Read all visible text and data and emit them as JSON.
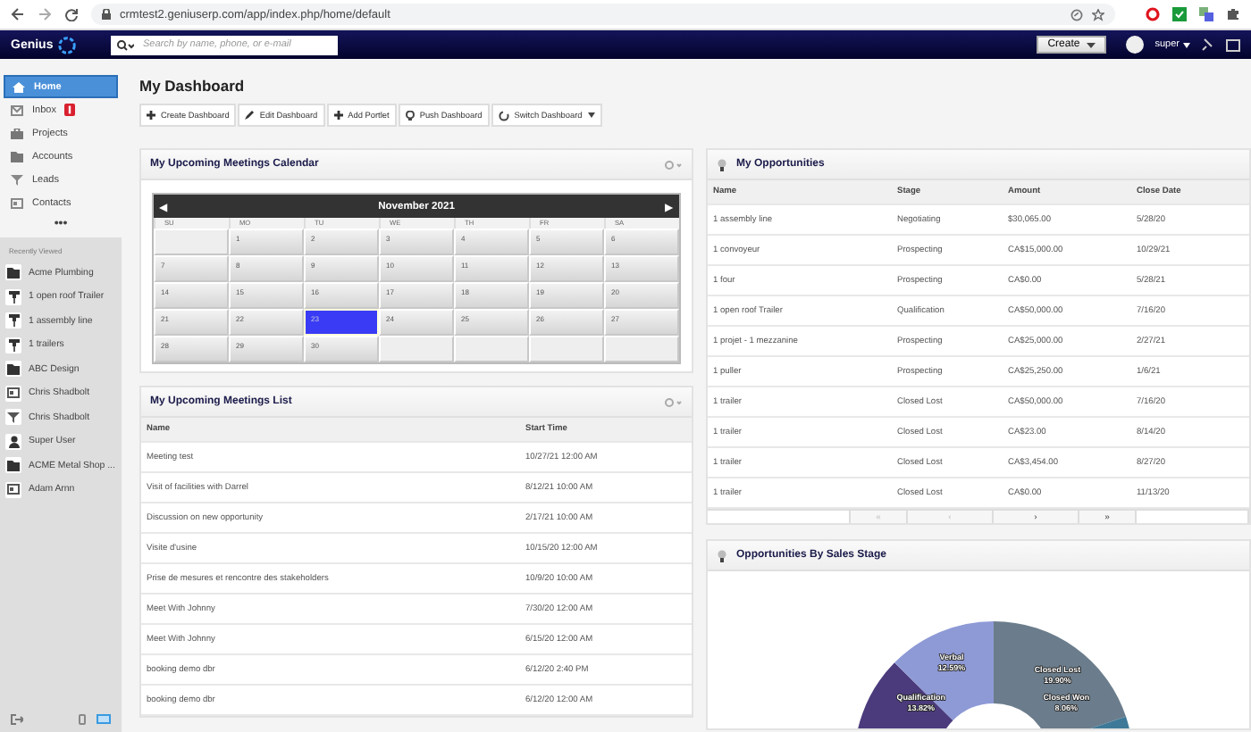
{
  "browser": {
    "url": "crmtest2.geniuserp.com/app/index.php/home/default"
  },
  "header": {
    "logo": "Genius",
    "search": {
      "placeholder": "Search by name, phone, or e-mail"
    },
    "create_button": "Create",
    "user": "super"
  },
  "sidebar": {
    "items": [
      {
        "label": "Home",
        "kind": "home",
        "selected": true,
        "badge": false
      },
      {
        "label": "Inbox",
        "kind": "inbox",
        "selected": false,
        "badge": true
      },
      {
        "label": "Projects",
        "kind": "projects",
        "selected": false,
        "badge": false
      },
      {
        "label": "Accounts",
        "kind": "accounts",
        "selected": false,
        "badge": false
      },
      {
        "label": "Leads",
        "kind": "leads",
        "selected": false,
        "badge": false
      },
      {
        "label": "Contacts",
        "kind": "contacts",
        "selected": false,
        "badge": false
      }
    ],
    "more": "•••",
    "recent_title": "Recently Viewed",
    "recent": [
      {
        "label": "Acme Plumbing",
        "kind": "account"
      },
      {
        "label": "1 open roof Trailer",
        "kind": "opportunity"
      },
      {
        "label": "1 assembly line",
        "kind": "opportunity"
      },
      {
        "label": "1 trailers",
        "kind": "opportunity"
      },
      {
        "label": "ABC Design",
        "kind": "account"
      },
      {
        "label": "Chris Shadbolt",
        "kind": "contact"
      },
      {
        "label": "Chris Shadbolt",
        "kind": "lead"
      },
      {
        "label": "Super User",
        "kind": "user"
      },
      {
        "label": "ACME Metal Shop ...",
        "kind": "account"
      },
      {
        "label": "Adam Arnn",
        "kind": "contact"
      }
    ]
  },
  "page": {
    "title": "My Dashboard",
    "toolbar": [
      {
        "label": "Create Dashboard",
        "kind": "plus"
      },
      {
        "label": "Edit Dashboard",
        "kind": "pencil"
      },
      {
        "label": "Add Portlet",
        "kind": "plus"
      },
      {
        "label": "Push Dashboard",
        "kind": "bulb"
      },
      {
        "label": "Switch Dashboard",
        "kind": "switch"
      }
    ]
  },
  "calendar": {
    "title": "My Upcoming Meetings Calendar",
    "month": "November 2021",
    "prev": "◀",
    "next": "▶",
    "weekdays": [
      "SU",
      "MO",
      "TU",
      "WE",
      "TH",
      "FR",
      "SA"
    ],
    "weeks": [
      [
        {
          "kind": "blank"
        },
        {
          "day": "1",
          "selected": false
        },
        {
          "day": "2",
          "selected": false
        },
        {
          "day": "3",
          "selected": false
        },
        {
          "day": "4",
          "selected": false
        },
        {
          "day": "5",
          "selected": false
        },
        {
          "day": "6",
          "selected": false
        }
      ],
      [
        {
          "day": "7",
          "selected": false
        },
        {
          "day": "8",
          "selected": false
        },
        {
          "day": "9",
          "selected": false
        },
        {
          "day": "10",
          "selected": false
        },
        {
          "day": "11",
          "selected": false
        },
        {
          "day": "12",
          "selected": false
        },
        {
          "day": "13",
          "selected": false
        }
      ],
      [
        {
          "day": "14",
          "selected": false
        },
        {
          "day": "15",
          "selected": false
        },
        {
          "day": "16",
          "selected": false
        },
        {
          "day": "17",
          "selected": false
        },
        {
          "day": "18",
          "selected": false
        },
        {
          "day": "19",
          "selected": false
        },
        {
          "day": "20",
          "selected": false
        }
      ],
      [
        {
          "day": "21",
          "selected": false
        },
        {
          "day": "22",
          "selected": false
        },
        {
          "day": "23",
          "selected": true
        },
        {
          "day": "24",
          "selected": false
        },
        {
          "day": "25",
          "selected": false
        },
        {
          "day": "26",
          "selected": false
        },
        {
          "day": "27",
          "selected": false
        }
      ],
      [
        {
          "day": "28",
          "selected": false
        },
        {
          "day": "29",
          "selected": false
        },
        {
          "day": "30",
          "selected": false
        },
        {
          "kind": "blank"
        },
        {
          "kind": "blank"
        },
        {
          "kind": "blank"
        },
        {
          "kind": "blank"
        }
      ]
    ]
  },
  "meetings": {
    "title": "My Upcoming Meetings List",
    "columns": [
      "Name",
      "Start Time"
    ],
    "rows": [
      [
        "Meeting test",
        "10/27/21 12:00 AM"
      ],
      [
        "Visit of facilities with Darrel",
        "8/12/21 10:00 AM"
      ],
      [
        "Discussion on new opportunity",
        "2/17/21 10:00 AM"
      ],
      [
        "Visite d'usine",
        "10/15/20 12:00 AM"
      ],
      [
        "Prise de mesures et rencontre des stakeholders",
        "10/9/20 10:00 AM"
      ],
      [
        "Meet With Johnny",
        "7/30/20 12:00 AM"
      ],
      [
        "Meet With Johnny",
        "6/15/20 12:00 AM"
      ],
      [
        "booking demo dbr",
        "6/12/20 2:40 PM"
      ],
      [
        "booking demo dbr",
        "6/12/20 12:00 AM"
      ]
    ]
  },
  "opportunities": {
    "title": "My Opportunities",
    "columns": [
      "Name",
      "Stage",
      "Amount",
      "Close Date"
    ],
    "rows": [
      [
        "1 assembly line",
        "Negotiating",
        "$30,065.00",
        "5/28/20"
      ],
      [
        "1 convoyeur",
        "Prospecting",
        "CA$15,000.00",
        "10/29/21"
      ],
      [
        "1 four",
        "Prospecting",
        "CA$0.00",
        "5/28/21"
      ],
      [
        "1 open roof Trailer",
        "Qualification",
        "CA$50,000.00",
        "7/16/20"
      ],
      [
        "1 projet - 1 mezzanine",
        "Prospecting",
        "CA$25,000.00",
        "2/27/21"
      ],
      [
        "1 puller",
        "Prospecting",
        "CA$25,250.00",
        "1/6/21"
      ],
      [
        "1 trailer",
        "Closed Lost",
        "CA$50,000.00",
        "7/16/20"
      ],
      [
        "1 trailer",
        "Closed Lost",
        "CA$23.00",
        "8/14/20"
      ],
      [
        "1 trailer",
        "Closed Lost",
        "CA$3,454.00",
        "8/27/20"
      ],
      [
        "1 trailer",
        "Closed Lost",
        "CA$0.00",
        "11/13/20"
      ]
    ],
    "pager": [
      {
        "label": "«",
        "disabled": true
      },
      {
        "label": "‹",
        "disabled": true
      },
      {
        "label": "›",
        "disabled": false
      },
      {
        "label": "»",
        "disabled": false
      }
    ]
  },
  "sales_stage": {
    "title": "Opportunities By Sales Stage",
    "slices": [
      {
        "label": "Qualification",
        "percent": "13.82%",
        "color": "#4b3b7c"
      },
      {
        "label": "Verbal",
        "percent": "12.59%",
        "color": "#8e9ad6"
      },
      {
        "label": "Closed Lost",
        "percent": "19.90%",
        "color": "#6b7d8c"
      },
      {
        "label": "Closed Won",
        "percent": "8.06%",
        "color": "#3e7a98"
      }
    ]
  }
}
